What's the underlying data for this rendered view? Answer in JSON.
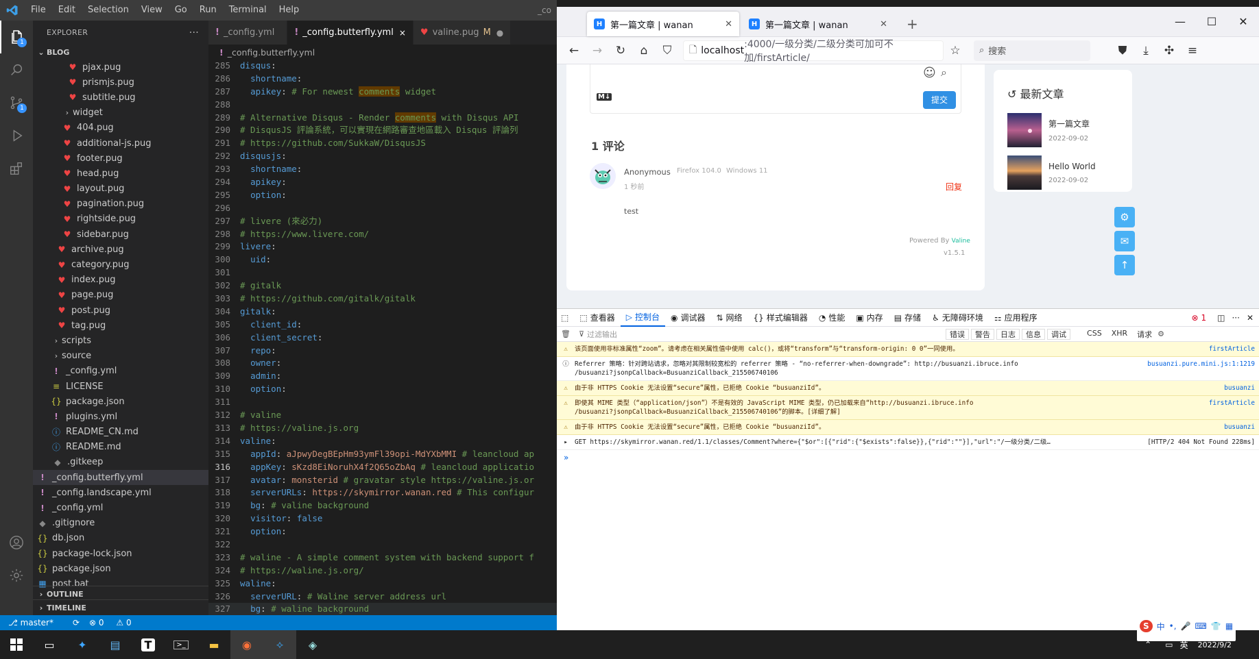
{
  "vscode": {
    "menu": [
      "File",
      "Edit",
      "Selection",
      "View",
      "Go",
      "Run",
      "Terminal",
      "Help"
    ],
    "title_fragment": "_co",
    "explorer_title": "EXPLORER",
    "root": "BLOG",
    "tree": [
      {
        "label": "pjax.pug",
        "type": "pug",
        "indent": 3
      },
      {
        "label": "prismjs.pug",
        "type": "pug",
        "indent": 3
      },
      {
        "label": "subtitle.pug",
        "type": "pug",
        "indent": 3
      },
      {
        "label": "widget",
        "type": "folder",
        "indent": 2
      },
      {
        "label": "404.pug",
        "type": "pug",
        "indent": 2
      },
      {
        "label": "additional-js.pug",
        "type": "pug",
        "indent": 2
      },
      {
        "label": "footer.pug",
        "type": "pug",
        "indent": 2
      },
      {
        "label": "head.pug",
        "type": "pug",
        "indent": 2
      },
      {
        "label": "layout.pug",
        "type": "pug",
        "indent": 2
      },
      {
        "label": "pagination.pug",
        "type": "pug",
        "indent": 2
      },
      {
        "label": "rightside.pug",
        "type": "pug",
        "indent": 2
      },
      {
        "label": "sidebar.pug",
        "type": "pug",
        "indent": 2
      },
      {
        "label": "archive.pug",
        "type": "pug",
        "indent": 1
      },
      {
        "label": "category.pug",
        "type": "pug",
        "indent": 1
      },
      {
        "label": "index.pug",
        "type": "pug",
        "indent": 1
      },
      {
        "label": "page.pug",
        "type": "pug",
        "indent": 1
      },
      {
        "label": "post.pug",
        "type": "pug",
        "indent": 1
      },
      {
        "label": "tag.pug",
        "type": "pug",
        "indent": 1
      },
      {
        "label": "scripts",
        "type": "folder",
        "indent": 0
      },
      {
        "label": "source",
        "type": "folder",
        "indent": 0
      },
      {
        "label": "_config.yml",
        "type": "yml",
        "indent": 0
      },
      {
        "label": "LICENSE",
        "type": "lic",
        "indent": 0
      },
      {
        "label": "package.json",
        "type": "json",
        "indent": 0
      },
      {
        "label": "plugins.yml",
        "type": "yml",
        "indent": 0
      },
      {
        "label": "README_CN.md",
        "type": "md",
        "indent": 0
      },
      {
        "label": "README.md",
        "type": "md",
        "indent": 0
      },
      {
        "label": ".gitkeep",
        "type": "git",
        "indent": -1
      },
      {
        "label": "_config.butterfly.yml",
        "type": "yml",
        "indent": -2,
        "selected": true
      },
      {
        "label": "_config.landscape.yml",
        "type": "yml",
        "indent": -2
      },
      {
        "label": "_config.yml",
        "type": "yml",
        "indent": -2
      },
      {
        "label": ".gitignore",
        "type": "git",
        "indent": -2
      },
      {
        "label": "db.json",
        "type": "json",
        "indent": -2
      },
      {
        "label": "package-lock.json",
        "type": "json",
        "indent": -2
      },
      {
        "label": "package.json",
        "type": "json",
        "indent": -2
      },
      {
        "label": "post.bat",
        "type": "bat",
        "indent": -2
      }
    ],
    "outline": "OUTLINE",
    "timeline": "TIMELINE",
    "tabs": [
      {
        "label": "_config.yml",
        "active": false
      },
      {
        "label": "_config.butterfly.yml",
        "active": true
      },
      {
        "label": "valine.pug",
        "active": false,
        "modified": "M"
      }
    ],
    "breadcrumb": "_config.butterfly.yml",
    "code": [
      [
        285,
        "disqus:"
      ],
      [
        286,
        "  shortname:"
      ],
      [
        287,
        "  apikey: # For newest comments widget"
      ],
      [
        288,
        ""
      ],
      [
        289,
        "# Alternative Disqus - Render comments with Disqus API"
      ],
      [
        290,
        "# DisqusJS 評論系統，可以實現在網路審查地區載入 Disqus 評論列"
      ],
      [
        291,
        "# https://github.com/SukkaW/DisqusJS"
      ],
      [
        292,
        "disqusjs:"
      ],
      [
        293,
        "  shortname:"
      ],
      [
        294,
        "  apikey:"
      ],
      [
        295,
        "  option:"
      ],
      [
        296,
        ""
      ],
      [
        297,
        "# livere (來必力)"
      ],
      [
        298,
        "# https://www.livere.com/"
      ],
      [
        299,
        "livere:"
      ],
      [
        300,
        "  uid:"
      ],
      [
        301,
        ""
      ],
      [
        302,
        "# gitalk"
      ],
      [
        303,
        "# https://github.com/gitalk/gitalk"
      ],
      [
        304,
        "gitalk:"
      ],
      [
        305,
        "  client_id:"
      ],
      [
        306,
        "  client_secret:"
      ],
      [
        307,
        "  repo:"
      ],
      [
        308,
        "  owner:"
      ],
      [
        309,
        "  admin:"
      ],
      [
        310,
        "  option:"
      ],
      [
        311,
        ""
      ],
      [
        312,
        "# valine"
      ],
      [
        313,
        "# https://valine.js.org"
      ],
      [
        314,
        "valine:"
      ],
      [
        315,
        "  appId: aJpwyDegBEpHm93ymFl39opi-MdYXbMMI # leancloud ap"
      ],
      [
        316,
        "  appKey: sKzd8EiNoruhX4f2Q65oZbAq # leancloud applicatio"
      ],
      [
        317,
        "  avatar: monsterid # gravatar style https://valine.js.or"
      ],
      [
        318,
        "  serverURLs: https://skymirror.wanan.red # This configur"
      ],
      [
        319,
        "  bg: # valine background"
      ],
      [
        320,
        "  visitor: false"
      ],
      [
        321,
        "  option:"
      ],
      [
        322,
        ""
      ],
      [
        323,
        "# waline - A simple comment system with backend support f"
      ],
      [
        324,
        "# https://waline.js.org/"
      ],
      [
        325,
        "waline:"
      ],
      [
        326,
        "  serverURL: # Waline server address url"
      ],
      [
        327,
        "  bg: # waline background"
      ]
    ],
    "status": {
      "branch": "master*",
      "errors": "0",
      "warnings": "0"
    }
  },
  "firefox": {
    "tabs": [
      {
        "title": "第一篇文章 | wanan",
        "active": true
      },
      {
        "title": "第一篇文章 | wanan",
        "active": false
      }
    ],
    "url_host": "localhost",
    "url_path": ":4000/一级分类/二级分类可加可不加/firstArticle/",
    "search_placeholder": "搜索",
    "page": {
      "submit": "提交",
      "comment_count": "1 评论",
      "comment": {
        "author": "Anonymous",
        "browser": "Firefox 104.0",
        "os": "Windows 11",
        "time": "1 秒前",
        "reply": "回复",
        "body": "test"
      },
      "powered_by": "Powered By",
      "powered_name": "Valine",
      "version": "v1.5.1",
      "recent_title": "最新文章",
      "articles": [
        {
          "title": "第一篇文章",
          "date": "2022-09-02"
        },
        {
          "title": "Hello World",
          "date": "2022-09-02"
        }
      ]
    },
    "devtools": {
      "tabs": [
        "查看器",
        "控制台",
        "调试器",
        "网络",
        "样式编辑器",
        "性能",
        "内存",
        "存储",
        "无障碍环境",
        "应用程序"
      ],
      "error_count": "1",
      "filter_placeholder": "过滤输出",
      "filter_buttons": [
        "错误",
        "警告",
        "日志",
        "信息",
        "调试"
      ],
      "filter_right": [
        "CSS",
        "XHR",
        "请求"
      ],
      "logs": [
        {
          "level": "warn",
          "msg": "该页面使用非标准属性“zoom”。请考虑在相关属性值中使用 calc()，或将“transform”与“transform-origin: 0 0”一同使用。",
          "src": "firstArticle"
        },
        {
          "level": "info",
          "msg": "Referrer 策略：针对跨站请求，忽略对其限制较宽松的 referrer 策略 - “no-referrer-when-downgrade”: http://busuanzi.ibruce.info\n/busuanzi?jsonpCallback=BusuanziCallback_215506740106",
          "src": "busuanzi.pure.mini.js:1:1219"
        },
        {
          "level": "warn",
          "msg": "由于非 HTTPS Cookie 无法设置“secure”属性，已拒绝 Cookie “busuanziId”。",
          "src": "busuanzi"
        },
        {
          "level": "warn",
          "msg": "即使其 MIME 类型（“application/json”）不是有效的 JavaScript MIME 类型，仍已加载来自“http://busuanzi.ibruce.info\n/busuanzi?jsonpCallback=BusuanziCallback_215506740106”的脚本。[详细了解]",
          "src": "firstArticle"
        },
        {
          "level": "warn",
          "msg": "由于非 HTTPS Cookie 无法设置“secure”属性，已拒绝 Cookie “busuanziId”。",
          "src": "busuanzi"
        },
        {
          "level": "xhr",
          "msg": "GET https://skymirror.wanan.red/1.1/classes/Comment?where={\"$or\":[{\"rid\":{\"$exists\":false}},{\"rid\":\"\"}],\"url\":\"/一级分类/二级…",
          "src": "[HTTP/2 404 Not Found 228ms]"
        }
      ]
    }
  },
  "taskbar": {
    "ime": "英",
    "ime2": "中",
    "date": "2022/9/2"
  }
}
